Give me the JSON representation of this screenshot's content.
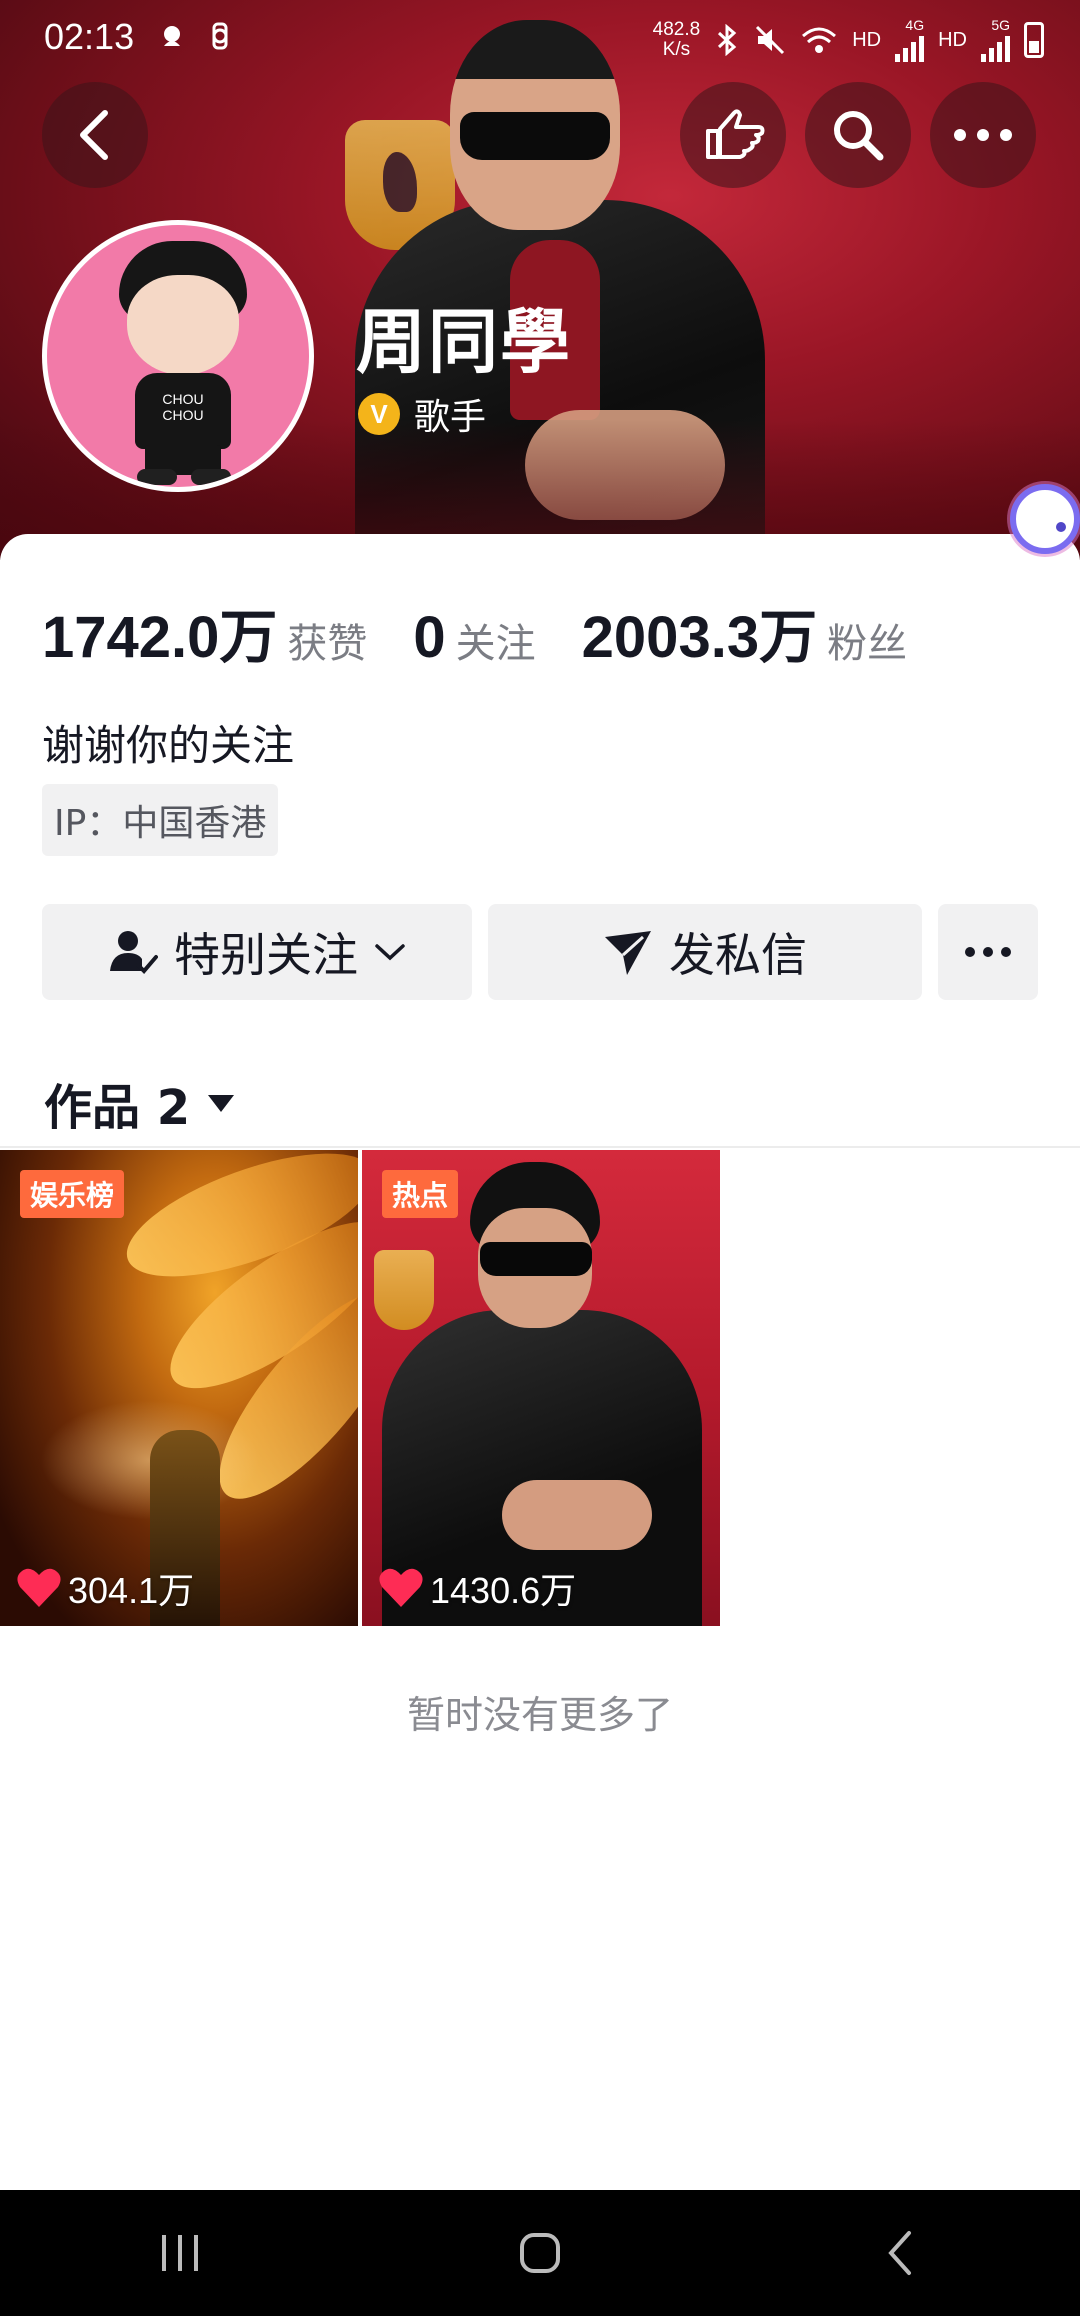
{
  "status_bar": {
    "time": "02:13",
    "net_speed_value": "482.8",
    "net_speed_unit": "K/s",
    "hd1": "HD",
    "sig1_type": "4G",
    "hd2": "HD",
    "sig2_type": "5G"
  },
  "header": {
    "icons": [
      "back-icon",
      "pointing-hand-icon",
      "search-icon",
      "more-icon"
    ]
  },
  "profile": {
    "name": "周同學",
    "verified_label": "歌手",
    "verified_badge_text": "V",
    "avatar_shirt_text": "CHOU CHOU"
  },
  "stats": [
    {
      "value": "1742.0万",
      "label": "获赞"
    },
    {
      "value": "0",
      "label": "关注"
    },
    {
      "value": "2003.3万",
      "label": "粉丝"
    }
  ],
  "bio": "谢谢你的关注",
  "ip_tag": "IP：中国香港",
  "actions": {
    "follow_label": "特别关注",
    "message_label": "发私信"
  },
  "works_tab": {
    "label": "作品 2"
  },
  "works": [
    {
      "badge": "娱乐榜",
      "likes": "304.1万"
    },
    {
      "badge": "热点",
      "likes": "1430.6万"
    }
  ],
  "footer_note": "暂时没有更多了",
  "colors": {
    "badge_orange": "#fe6a3d",
    "heart_red": "#fe2c55",
    "verified_gold": "#f4b41a"
  }
}
